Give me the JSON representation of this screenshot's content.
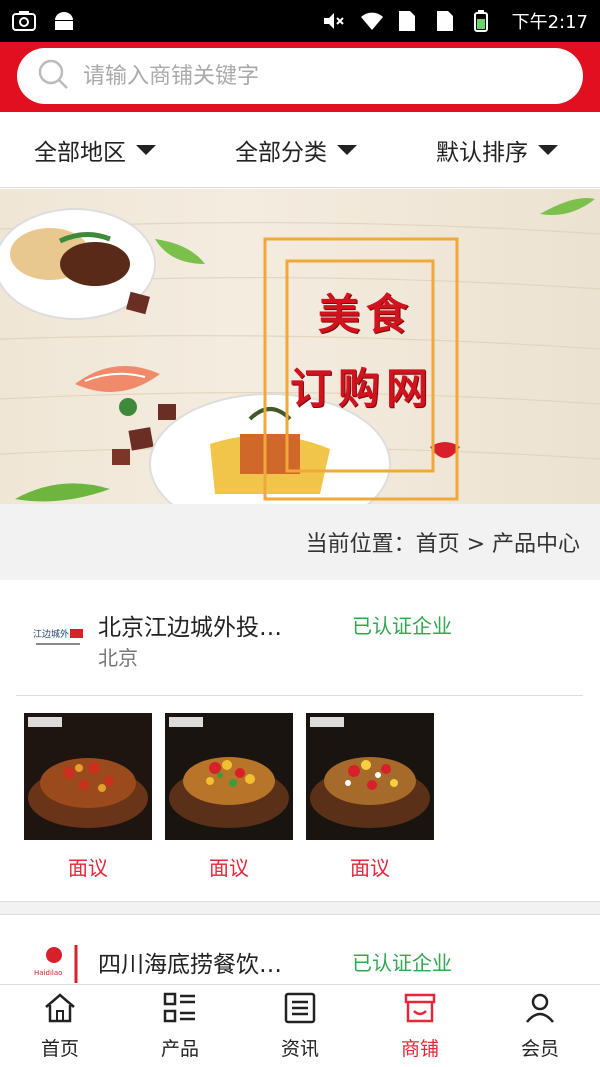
{
  "status_bar": {
    "time": "下午2:17"
  },
  "search": {
    "placeholder": "请输入商铺关键字"
  },
  "filters": [
    {
      "label": "全部地区"
    },
    {
      "label": "全部分类"
    },
    {
      "label": "默认排序"
    }
  ],
  "banner": {
    "line1": "美食",
    "line2": "订购网"
  },
  "breadcrumb": {
    "text": "当前位置：首页 > 产品中心"
  },
  "companies": [
    {
      "name": "北京江边城外投…",
      "city": "北京",
      "certified": "已认证企业",
      "logo_text": "江边城外",
      "products": [
        {
          "price": "面议"
        },
        {
          "price": "面议"
        },
        {
          "price": "面议"
        }
      ]
    },
    {
      "name": "四川海底捞餐饮…",
      "certified": "已认证企业",
      "logo_text": "Haidilao"
    }
  ],
  "bottom_nav": [
    {
      "label": "首页",
      "icon": "home-icon"
    },
    {
      "label": "产品",
      "icon": "list-icon"
    },
    {
      "label": "资讯",
      "icon": "news-icon"
    },
    {
      "label": "商铺",
      "icon": "shop-icon",
      "active": true
    },
    {
      "label": "会员",
      "icon": "user-icon"
    }
  ],
  "colors": {
    "brand_red": "#e10f1f",
    "certified_green": "#2fa84f",
    "price_red": "#e5273a"
  }
}
